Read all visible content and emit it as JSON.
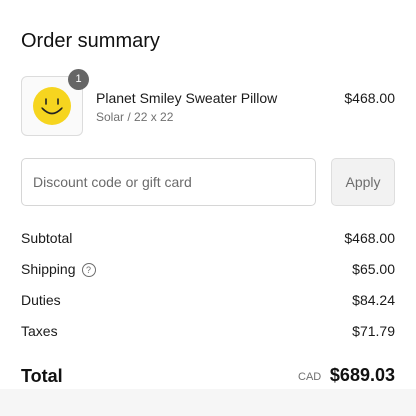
{
  "summary": {
    "heading": "Order summary"
  },
  "product": {
    "quantity": "1",
    "name": "Planet Smiley Sweater Pillow",
    "variant": "Solar / 22 x 22",
    "price": "$468.00",
    "image_icon": "smiley-face"
  },
  "discount": {
    "placeholder": "Discount code or gift card",
    "value": "",
    "apply_label": "Apply"
  },
  "totals": {
    "subtotal_label": "Subtotal",
    "subtotal_value": "$468.00",
    "shipping_label": "Shipping",
    "shipping_help_icon": "question-circle",
    "shipping_help_glyph": "?",
    "shipping_value": "$65.00",
    "duties_label": "Duties",
    "duties_value": "$84.24",
    "taxes_label": "Taxes",
    "taxes_value": "$71.79",
    "total_label": "Total",
    "currency": "CAD",
    "total_value": "$689.03"
  },
  "colors": {
    "smiley_yellow": "#f6d51f",
    "badge": "#666666"
  }
}
